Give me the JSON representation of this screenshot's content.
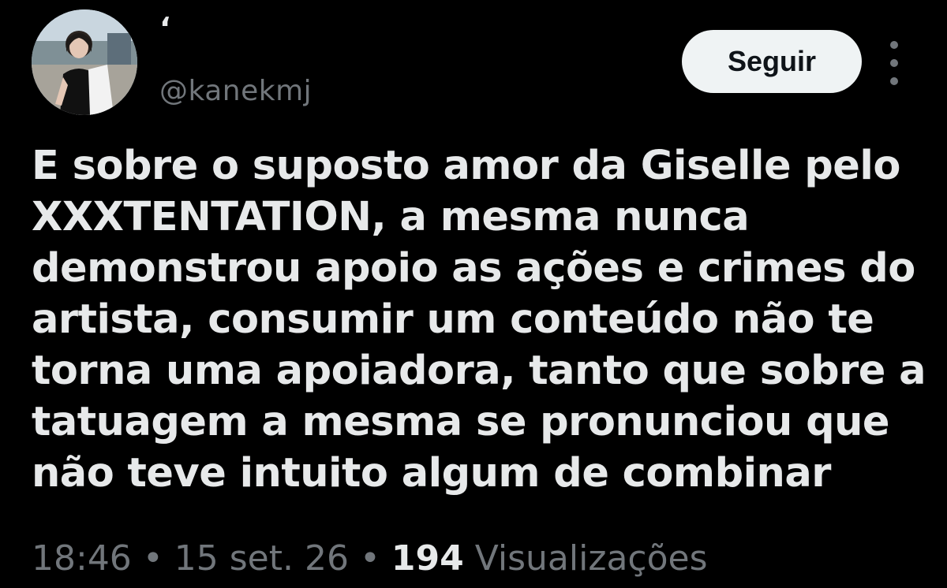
{
  "author": {
    "display_name": "‘",
    "handle": "@kanekmj",
    "avatar_icon": "profile-photo"
  },
  "actions": {
    "follow_label": "Seguir",
    "more_icon": "more-vertical-icon"
  },
  "tweet": {
    "lines": [
      "E sobre o suposto amor da Giselle pelo",
      "XXXTENTATION, a mesma nunca",
      "demonstrou apoio as ações e crimes do",
      "artista, consumir um conteúdo não te",
      "torna uma apoiadora, tanto que sobre a",
      "tatuagem a mesma se pronunciou que",
      "não teve intuito algum de combinar"
    ]
  },
  "meta": {
    "time": "18:46",
    "separator": "•",
    "date": "15 set. 26",
    "views_count": "194",
    "views_label": "Visualizações"
  },
  "colors": {
    "background": "#000000",
    "text_primary": "#e7e9ea",
    "text_secondary": "#71767b",
    "button_bg": "#eff3f4",
    "button_text": "#0f1419"
  }
}
